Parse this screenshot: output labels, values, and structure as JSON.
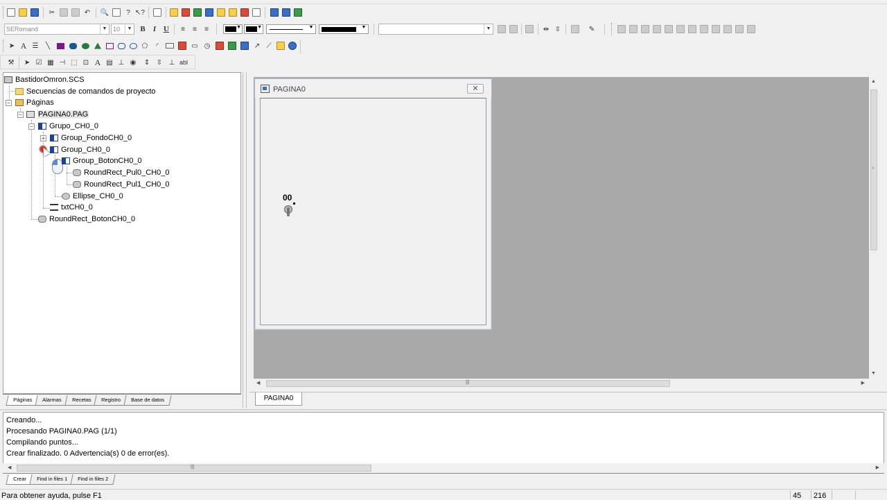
{
  "toolbar": {
    "font_name": "SERomand",
    "font_size": "10",
    "bold": "B",
    "italic": "I",
    "underline": "U",
    "text_tool": "A",
    "label_tool": "abl"
  },
  "tree": {
    "root": "BastidorOmron.SCS",
    "items": [
      {
        "label": "Secuencias de comandos de proyecto"
      },
      {
        "label": "Páginas"
      },
      {
        "label": "PAGINA0.PAG"
      },
      {
        "label": "Grupo_CH0_0"
      },
      {
        "label": "Group_FondoCH0_0"
      },
      {
        "label": "Group_CH0_0"
      },
      {
        "label": "Group_BotonCH0_0"
      },
      {
        "label": "RoundRect_Pul0_CH0_0"
      },
      {
        "label": "RoundRect_Pul1_CH0_0"
      },
      {
        "label": "Ellipse_CH0_0"
      },
      {
        "label": "txtCH0_0"
      },
      {
        "label": "RoundRect_BotonCH0_0"
      }
    ],
    "tabs": [
      "Páginas",
      "Alarmas",
      "Recetas",
      "Registro",
      "Base de datos"
    ]
  },
  "doc": {
    "window_title": "PAGINA0",
    "object_label": "00",
    "tab": "PAGINA0"
  },
  "output": {
    "lines": [
      "Creando...",
      "Procesando  PAGINA0.PAG (1/1)",
      "Compilando puntos...",
      "Crear finalizado. 0 Advertencia(s) 0 de error(es)."
    ],
    "tabs": [
      "Crear",
      "Find in files 1",
      "Find in files 2"
    ]
  },
  "status": {
    "help": "Para obtener ayuda, pulse F1",
    "x": "45",
    "y": "216"
  },
  "colors": {
    "canvas": "#a9a9a9",
    "selection_bg": "#e8e8e8"
  }
}
